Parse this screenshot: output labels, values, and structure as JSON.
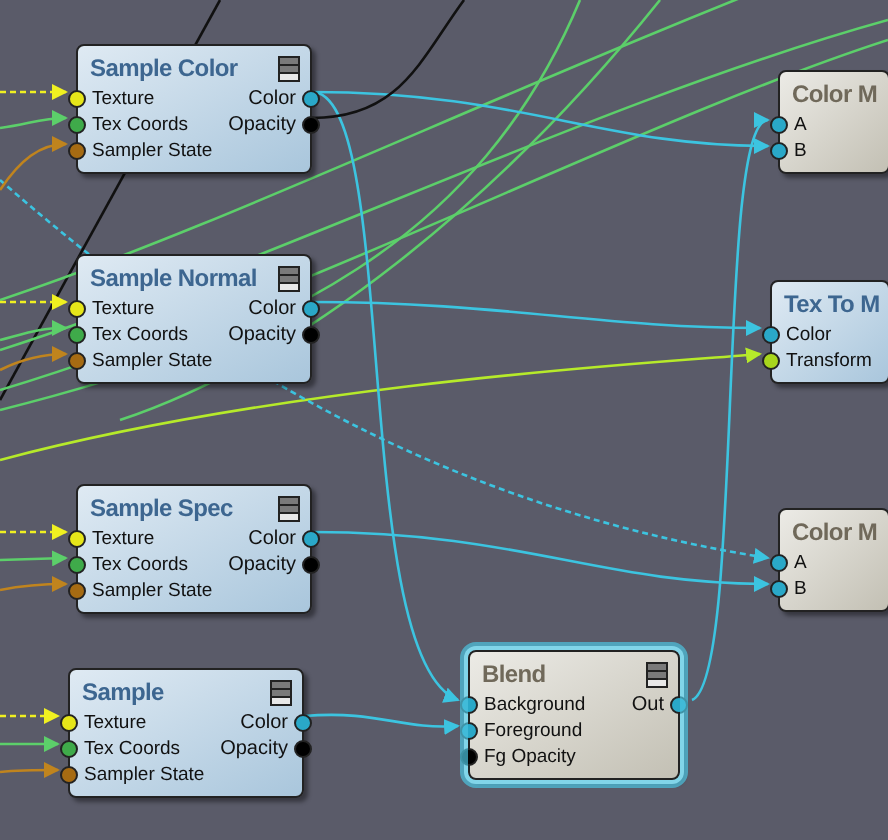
{
  "nodes": [
    {
      "title": "Sample Color",
      "kind": "texture",
      "selected": false,
      "inputs": [
        {
          "label": "Texture",
          "color": "#e6e619"
        },
        {
          "label": "Tex Coords",
          "color": "#3faa4a"
        },
        {
          "label": "Sampler State",
          "color": "#a66b12"
        }
      ],
      "outputs": [
        {
          "label": "Color",
          "color": "#2aa8c8"
        },
        {
          "label": "Opacity",
          "color": "#000000"
        }
      ]
    },
    {
      "title": "Sample Normal",
      "kind": "texture",
      "selected": false,
      "inputs": [
        {
          "label": "Texture",
          "color": "#e6e619"
        },
        {
          "label": "Tex Coords",
          "color": "#3faa4a"
        },
        {
          "label": "Sampler State",
          "color": "#a66b12"
        }
      ],
      "outputs": [
        {
          "label": "Color",
          "color": "#2aa8c8"
        },
        {
          "label": "Opacity",
          "color": "#000000"
        }
      ]
    },
    {
      "title": "Sample Spec",
      "kind": "texture",
      "selected": false,
      "inputs": [
        {
          "label": "Texture",
          "color": "#e6e619"
        },
        {
          "label": "Tex Coords",
          "color": "#3faa4a"
        },
        {
          "label": "Sampler State",
          "color": "#a66b12"
        }
      ],
      "outputs": [
        {
          "label": "Color",
          "color": "#2aa8c8"
        },
        {
          "label": "Opacity",
          "color": "#000000"
        }
      ]
    },
    {
      "title": "Sample",
      "kind": "texture",
      "selected": false,
      "inputs": [
        {
          "label": "Texture",
          "color": "#e6e619"
        },
        {
          "label": "Tex Coords",
          "color": "#3faa4a"
        },
        {
          "label": "Sampler State",
          "color": "#a66b12"
        }
      ],
      "outputs": [
        {
          "label": "Color",
          "color": "#2aa8c8"
        },
        {
          "label": "Opacity",
          "color": "#000000"
        }
      ]
    },
    {
      "title": "Color M",
      "kind": "math",
      "selected": false,
      "inputs": [
        {
          "label": "A",
          "color": "#2aa8c8"
        },
        {
          "label": "B",
          "color": "#2aa8c8"
        }
      ]
    },
    {
      "title": "Tex To M",
      "kind": "texture",
      "selected": false,
      "inputs": [
        {
          "label": "Color",
          "color": "#2aa8c8"
        },
        {
          "label": "Transform",
          "color": "#a8d61c"
        }
      ]
    },
    {
      "title": "Color M",
      "kind": "math",
      "selected": false,
      "inputs": [
        {
          "label": "A",
          "color": "#2aa8c8"
        },
        {
          "label": "B",
          "color": "#2aa8c8"
        }
      ]
    },
    {
      "title": "Blend",
      "kind": "math",
      "selected": true,
      "inputs": [
        {
          "label": "Background",
          "color": "#2aa8c8"
        },
        {
          "label": "Foreground",
          "color": "#2aa8c8"
        },
        {
          "label": "Fg Opacity",
          "color": "#000000"
        }
      ],
      "outputs": [
        {
          "label": "Out",
          "color": "#2aa8c8"
        }
      ]
    }
  ]
}
